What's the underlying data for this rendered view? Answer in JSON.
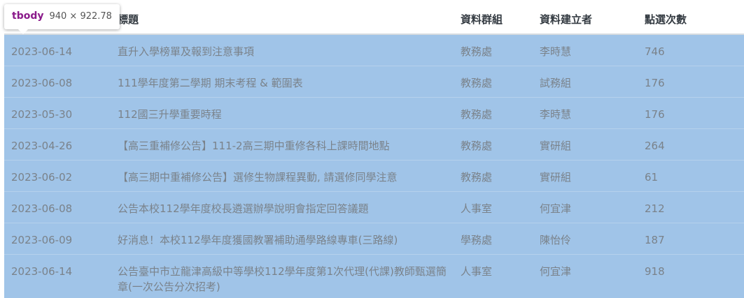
{
  "tooltip": {
    "tag": "tbody",
    "dims": "940 × 922.78"
  },
  "header": {
    "date": "",
    "title": "標題",
    "group": "資料群組",
    "creator": "資料建立者",
    "clicks": "點選次數"
  },
  "rows": [
    {
      "date": "2023-06-14",
      "title": "直升入學榜單及報到注意事項",
      "group": "教務處",
      "creator": "李時慧",
      "clicks": "746"
    },
    {
      "date": "2023-06-08",
      "title": "111學年度第二學期 期末考程 & 範圍表",
      "group": "教務處",
      "creator": "試務組",
      "clicks": "176"
    },
    {
      "date": "2023-05-30",
      "title": "112國三升學重要時程",
      "group": "教務處",
      "creator": "李時慧",
      "clicks": "176"
    },
    {
      "date": "2023-04-26",
      "title": "【高三重補修公告】111-2高三期中重修各科上課時間地點",
      "group": "教務處",
      "creator": "實研組",
      "clicks": "264"
    },
    {
      "date": "2023-06-02",
      "title": "【高三期中重補修公告】選修生物課程異動, 請選修同學注意",
      "group": "教務處",
      "creator": "實研組",
      "clicks": "61"
    },
    {
      "date": "2023-06-08",
      "title": "公告本校112學年度校長遴選辦學說明會指定回答議題",
      "group": "人事室",
      "creator": "何宜津",
      "clicks": "212"
    },
    {
      "date": "2023-06-09",
      "title": "好消息！本校112學年度獲國教署補助通學路線專車(三路線)",
      "group": "學務處",
      "creator": "陳怡伶",
      "clicks": "187"
    },
    {
      "date": "2023-06-14",
      "title": "公告臺中市立龍津高級中等學校112學年度第1次代理(代課)教師甄選簡章(一次公告分次招考)",
      "group": "人事室",
      "creator": "何宜津",
      "clicks": "918"
    }
  ]
}
